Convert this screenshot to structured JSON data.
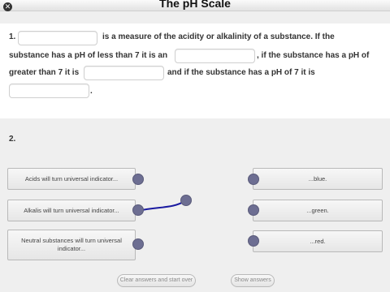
{
  "title": "The pH Scale",
  "q1": {
    "number": "1.",
    "line1_text": "is a measure of the acidity or alkalinity of a substance. If the",
    "line2_text_a": "substance has a pH of less than 7 it is an",
    "line2_text_b": ", if the substance has a pH of",
    "line3_text_a": "greater than 7 it is",
    "line3_text_b": "and if the substance has a pH of 7 it is",
    "line4_text": "."
  },
  "q2": {
    "number": "2.",
    "left_items": [
      "Acids will turn universal indicator...",
      "Alkalis will turn universal indicator...",
      "Neutral substances will turn universal indicator..."
    ],
    "right_items": [
      "...blue.",
      "...green.",
      "...red."
    ]
  },
  "buttons": {
    "clear": "Clear answers and start over",
    "show": "Show answers"
  },
  "colors": {
    "dot": "#6d6e92",
    "wire": "#1a1aa0"
  }
}
